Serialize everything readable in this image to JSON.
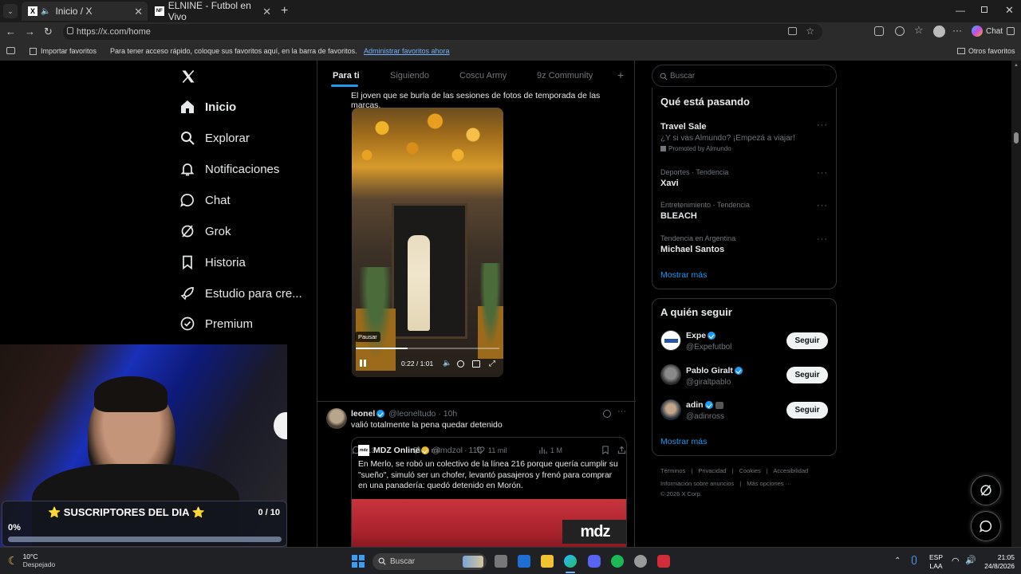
{
  "browser": {
    "tabs": [
      {
        "title": "Inicio / X"
      },
      {
        "title": "ELNINE - Futbol en Vivo"
      }
    ],
    "url": "https://x.com/home",
    "copilot_label": "Chat",
    "favorites": {
      "import": "Importar favoritos",
      "hint": "Para tener acceso rápido, coloque sus favoritos aquí, en la barra de favoritos.",
      "manage": "Administrar favoritos ahora",
      "others": "Otros favoritos"
    }
  },
  "sidebar": {
    "items": [
      {
        "label": "Inicio",
        "icon": "home-icon"
      },
      {
        "label": "Explorar",
        "icon": "search-icon"
      },
      {
        "label": "Notificaciones",
        "icon": "bell-icon"
      },
      {
        "label": "Chat",
        "icon": "chat-icon"
      },
      {
        "label": "Grok",
        "icon": "grok-icon"
      },
      {
        "label": "Historia",
        "icon": "bookmark-icon"
      },
      {
        "label": "Estudio para cre...",
        "icon": "rocket-icon"
      },
      {
        "label": "Premium",
        "icon": "premium-icon"
      }
    ]
  },
  "feed": {
    "tabs": [
      "Para ti",
      "Siguiendo",
      "Coscu Army",
      "9z Community"
    ],
    "post1": {
      "text": "El joven que se burla de las sesiones de fotos de temporada de las marcas.",
      "video": {
        "tooltip": "Pausar",
        "time": "0:22 / 1:01",
        "progress": 0.36
      },
      "stats": {
        "replies": "113",
        "reposts": "1 mil",
        "likes": "11 mil",
        "views": "1 M"
      }
    },
    "post2": {
      "author": "leonel",
      "handle": "@leoneltudo",
      "time": "10h",
      "text": "valió totalmente la pena quedar detenido",
      "quote": {
        "author": "MDZ Online",
        "handle": "@mdzol",
        "time": "11h",
        "logo": "mdz",
        "text": "En Merlo, se robó un colectivo de la línea 216 porque quería cumplir su \"sueño\", simuló ser un chofer, levantó pasajeros y frenó para comprar en una panadería: quedó detenido en Morón.",
        "image_logo": "mdz"
      }
    }
  },
  "right": {
    "search_placeholder": "Buscar",
    "trends_title": "Qué está pasando",
    "trends": [
      {
        "meta": "",
        "title": "Travel Sale",
        "sub": "¿Y si vas Almundo? ¡Empezá a viajar!",
        "promo": "Promoted by Almundo"
      },
      {
        "meta": "Deportes · Tendencia",
        "title": "Xavi"
      },
      {
        "meta": "Entretenimiento · Tendencia",
        "title": "BLEACH"
      },
      {
        "meta": "Tendencia en Argentina",
        "title": "Michael Santos"
      }
    ],
    "show_more": "Mostrar más",
    "follow_title": "A quién seguir",
    "follow": [
      {
        "name": "Expe",
        "handle": "@Expefutbol",
        "button": "Seguir"
      },
      {
        "name": "Pablo Giralt",
        "handle": "@giraltpablo",
        "button": "Seguir"
      },
      {
        "name": "adin",
        "handle": "@adinross",
        "button": "Seguir"
      }
    ],
    "follow_more": "Mostrar más",
    "footer": {
      "line1": [
        "Términos",
        "Privacidad",
        "Cookies",
        "Accesibilidad"
      ],
      "line2": [
        "Información sobre anuncios",
        "Más opciones ···"
      ],
      "copyright": "© 2026 X Corp."
    }
  },
  "overlay": {
    "title": "⭐ SUSCRIPTORES DEL DIA ⭐",
    "count": "0 / 10",
    "percent": "0%",
    "progress": 0
  },
  "taskbar": {
    "weather_temp": "10°C",
    "weather_desc": "Despejado",
    "search": "Buscar",
    "lang1": "ESP",
    "lang2": "LAA",
    "time": "21:05",
    "date": "24/8/2026"
  },
  "colors": {
    "accent": "#1d9bf0",
    "bg": "#000000",
    "border": "#2f3336"
  }
}
